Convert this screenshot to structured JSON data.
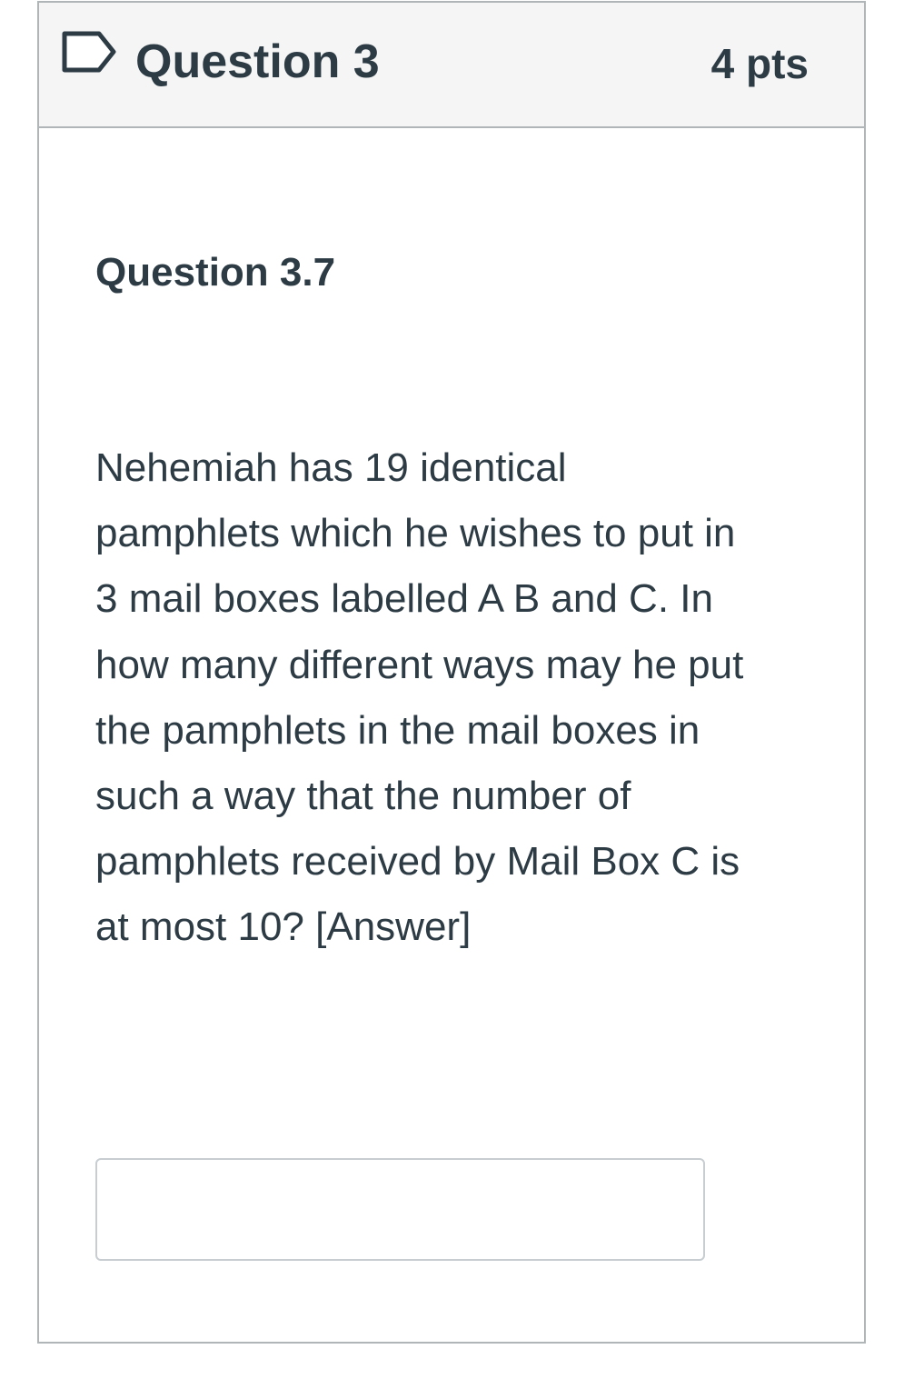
{
  "question": {
    "title": "Question 3",
    "points": "4 pts",
    "flag_icon": "flag-outline-icon",
    "sub_title": "Question 3.7",
    "text_lines": [
      "Nehemiah has 19 identical",
      "pamphlets which he wishes to put in",
      "3 mail boxes labelled A B and C. In",
      "how many different ways may he put",
      "the pamphlets in the mail boxes in",
      "such a way that the number of",
      "pamphlets received by Mail Box C is",
      "at most 10? [Answer]"
    ],
    "answer_value": "",
    "answer_placeholder": ""
  },
  "colors": {
    "text": "#2d3b45",
    "header_bg": "#f5f5f5",
    "border": "#b0b5b8",
    "input_border": "#c7cdd1"
  }
}
